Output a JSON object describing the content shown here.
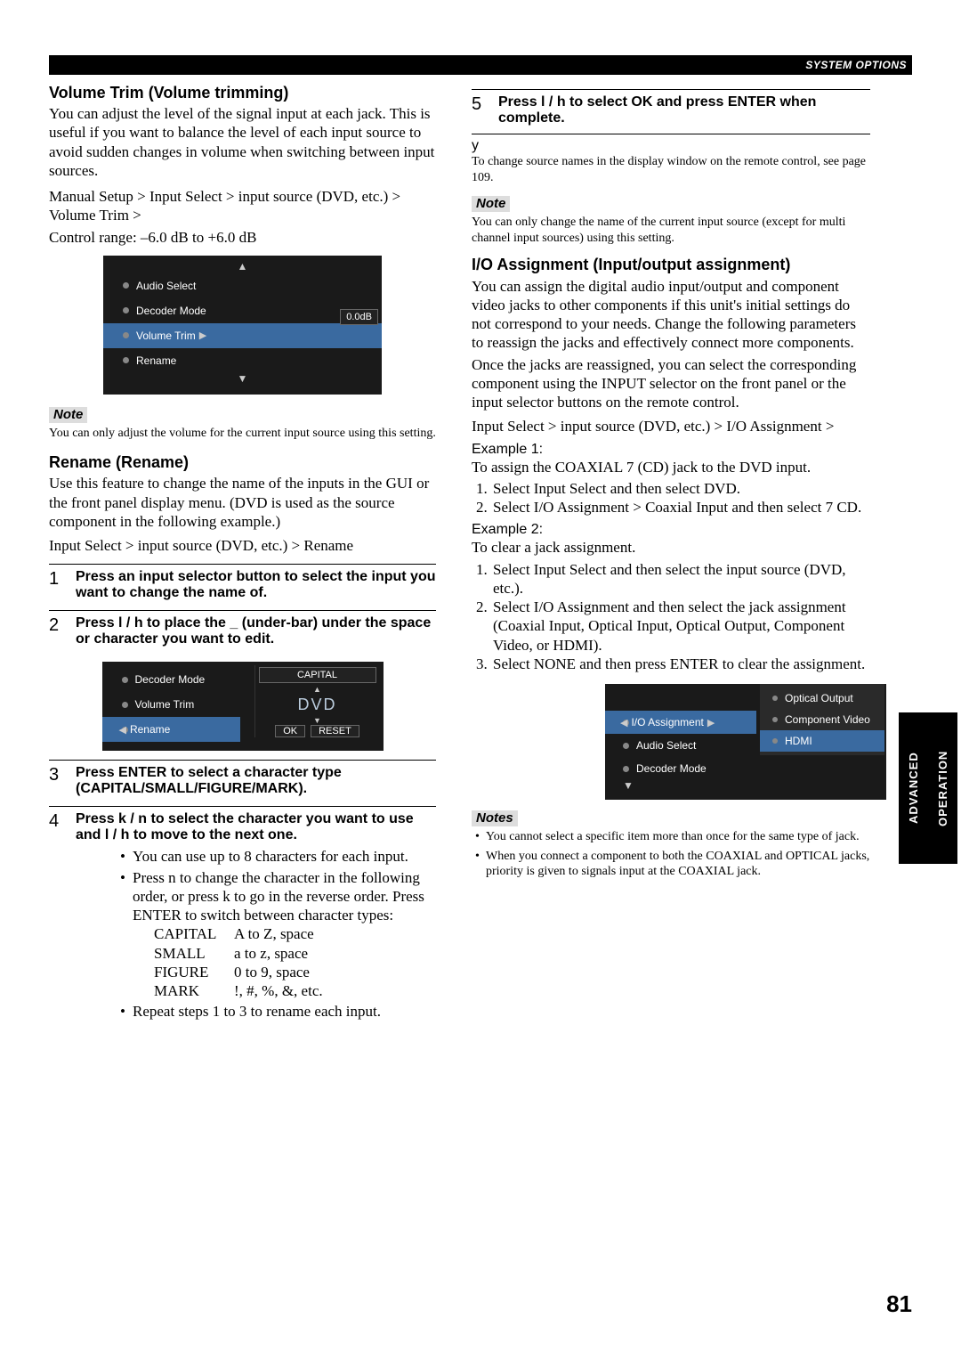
{
  "header": {
    "section": "SYSTEM OPTIONS"
  },
  "page_number": "81",
  "side_tab": {
    "line1": "ADVANCED",
    "line2": "OPERATION"
  },
  "left": {
    "vol_trim": {
      "title": "Volume Trim (Volume trimming)",
      "p1": "You can adjust the level of the signal input at each jack. This is useful if you want to balance the level of each input source to avoid sudden changes in volume when switching between input sources.",
      "p2": "Manual Setup > Input Select > input source (DVD, etc.) > Volume Trim >",
      "p3": "Control range: –6.0 dB to +6.0 dB",
      "gui": {
        "items": [
          "Audio Select",
          "Decoder Mode",
          "Volume Trim",
          "Rename"
        ],
        "selected_index": 2,
        "value": "0.0dB"
      },
      "note_label": "Note",
      "note": "You can only adjust the volume for the current input source using this setting."
    },
    "rename": {
      "title": "Rename (Rename)",
      "p1": "Use this feature to change the name of the inputs in the GUI or the front panel display menu. (DVD is used as the source component in the following example.)",
      "p2": "Input Select > input source (DVD, etc.) > Rename",
      "steps": {
        "s1": "Press an input selector button to select the input you want to change the name of.",
        "s2": "Press l  / h  to place the _ (under-bar) under the space or character you want to edit.",
        "gui2": {
          "left_items": [
            "Decoder Mode",
            "Volume Trim",
            "Rename"
          ],
          "selected_index": 2,
          "right_box": "CAPITAL",
          "value": "DVD",
          "btn1": "OK",
          "btn2": "RESET"
        },
        "s3": "Press ENTER to select a character type (CAPITAL/SMALL/FIGURE/MARK).",
        "s4": "Press k / n  to select the character you want to use and l  / h  to move to the next one.",
        "b1": "You can use up to 8 characters for each input.",
        "b2": "Press n  to change the character in the following order, or press k  to go in the reverse order. Press ENTER to switch between character types:",
        "grid": {
          "r1a": "CAPITAL",
          "r1b": "A to Z, space",
          "r2a": "SMALL",
          "r2b": "a to z, space",
          "r3a": "FIGURE",
          "r3b": "0 to 9, space",
          "r4a": "MARK",
          "r4b": "!, #, %, &, etc."
        },
        "b3": "Repeat steps 1 to 3 to rename each input."
      }
    }
  },
  "right": {
    "s5": "Press l  / h  to select OK and press ENTER when complete.",
    "y": "y",
    "y_note": "To change source names in the display window on the remote control, see page 109.",
    "note_label": "Note",
    "note": "You can only change the name of the current input source (except for multi channel input sources) using this setting.",
    "io": {
      "title": "I/O Assignment (Input/output assignment)",
      "p1": "You can assign the digital audio input/output and component video jacks to other components if this unit's initial settings do not correspond to your needs. Change the following parameters to reassign the jacks and effectively connect more components.",
      "p2": "Once the jacks are reassigned, you can select the corresponding component using the INPUT selector on the front panel or the input selector buttons on the remote control.",
      "p3": "Input Select > input source (DVD, etc.) > I/O Assignment >",
      "ex1_hd": "Example 1:",
      "ex1_p": "To assign the COAXIAL 7  (CD) jack to the DVD input.",
      "ex1_1": "Select Input Select and then select DVD.",
      "ex1_2": "Select I/O Assignment > Coaxial Input and then select 7  CD.",
      "ex2_hd": "Example 2:",
      "ex2_p": "To clear a jack assignment.",
      "ex2_1": "Select Input Select and then select the input source (DVD, etc.).",
      "ex2_2": "Select I/O Assignment and then select the jack assignment (Coaxial Input, Optical Input, Optical Output, Component Video, or HDMI).",
      "ex2_3": "Select NONE and then press ENTER to clear the assignment.",
      "gui3": {
        "left_items": [
          "I/O Assignment",
          "Audio Select",
          "Decoder Mode"
        ],
        "left_sel": 0,
        "right_items": [
          "Optical Output",
          "Component Video",
          "HDMI"
        ],
        "right_sel": 2
      },
      "notes_label": "Notes",
      "nb1": "You cannot select a specific item more than once for the same type of jack.",
      "nb2": "When you connect a component to both the COAXIAL and OPTICAL jacks, priority is given to signals input at the COAXIAL jack."
    }
  }
}
